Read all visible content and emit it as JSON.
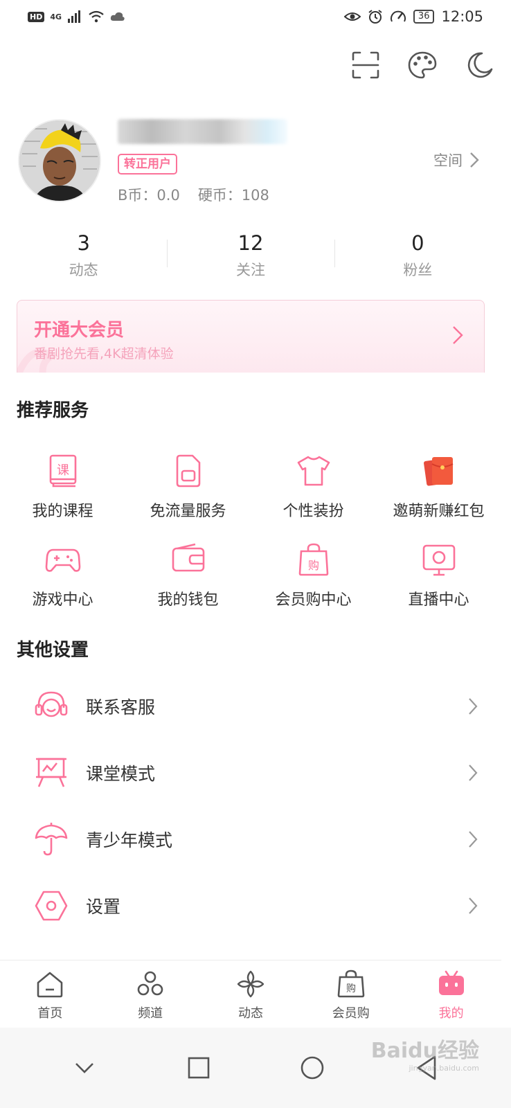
{
  "status_bar": {
    "hd": "HD",
    "network": "4G",
    "battery": "36",
    "time": "12:05"
  },
  "top_icons": [
    "scan-icon",
    "palette-icon",
    "moon-icon"
  ],
  "profile": {
    "badge": "转正用户",
    "b_coin": "B币：0.0",
    "hard_coin": "硬币：108",
    "space_label": "空间"
  },
  "stats": [
    {
      "value": "3",
      "label": "动态"
    },
    {
      "value": "12",
      "label": "关注"
    },
    {
      "value": "0",
      "label": "粉丝"
    }
  ],
  "vip": {
    "title": "开通大会员",
    "subtitle": "番剧抢先看,4K超清体验"
  },
  "recommended": {
    "title": "推荐服务",
    "items": [
      {
        "label": "我的课程",
        "icon": "course-book-icon"
      },
      {
        "label": "免流量服务",
        "icon": "sim-card-icon"
      },
      {
        "label": "个性装扮",
        "icon": "tshirt-icon"
      },
      {
        "label": "邀萌新赚红包",
        "icon": "red-envelope-icon"
      },
      {
        "label": "游戏中心",
        "icon": "gamepad-icon"
      },
      {
        "label": "我的钱包",
        "icon": "wallet-icon"
      },
      {
        "label": "会员购中心",
        "icon": "shopping-bag-icon"
      },
      {
        "label": "直播中心",
        "icon": "tv-live-icon"
      }
    ]
  },
  "other": {
    "title": "其他设置",
    "items": [
      {
        "label": "联系客服",
        "icon": "headset-icon"
      },
      {
        "label": "课堂模式",
        "icon": "presentation-board-icon"
      },
      {
        "label": "青少年模式",
        "icon": "umbrella-icon"
      },
      {
        "label": "设置",
        "icon": "settings-hex-icon"
      }
    ]
  },
  "bottom_nav": [
    {
      "label": "首页",
      "icon": "home-icon"
    },
    {
      "label": "频道",
      "icon": "channel-icon"
    },
    {
      "label": "动态",
      "icon": "pinwheel-icon"
    },
    {
      "label": "会员购",
      "icon": "shopping-bag-icon"
    },
    {
      "label": "我的",
      "icon": "tv-mascot-icon",
      "active": true
    }
  ],
  "colors": {
    "accent": "#fb7299",
    "text": "#222222",
    "muted": "#999999"
  },
  "watermark": {
    "text": "Baidu经验",
    "url": "jingyan.baidu.com"
  }
}
